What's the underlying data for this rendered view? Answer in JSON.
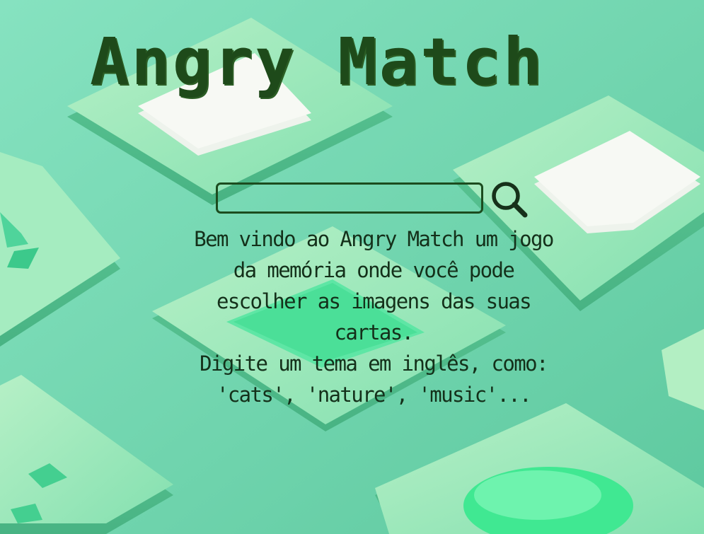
{
  "title": "Angry Match",
  "search": {
    "value": "",
    "placeholder": ""
  },
  "search_button_icon": "search-icon",
  "welcome": {
    "paragraph_1": "Bem vindo ao Angry Match um jogo da memória onde você pode escolher as imagens das suas cartas.",
    "paragraph_2": "Digite um tema em inglês, como: 'cats', 'nature', 'music'..."
  },
  "colors": {
    "background": "#74d9b3",
    "title": "#1e4a1a",
    "text": "#14301a",
    "input_border": "#1c4c1f"
  }
}
